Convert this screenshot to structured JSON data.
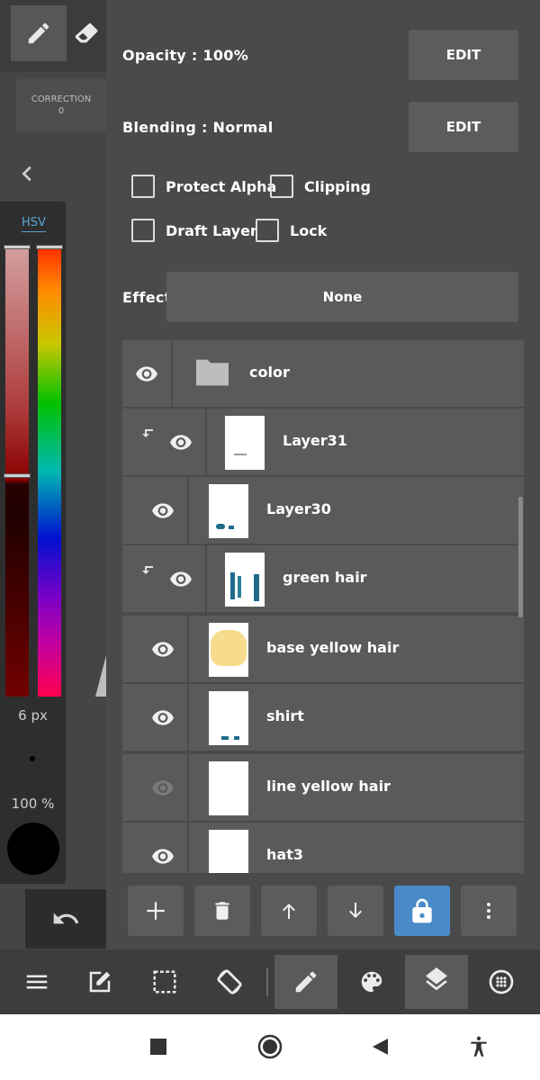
{
  "tools": {
    "correction_label": "CORRECTION",
    "correction_value": "0"
  },
  "color_panel": {
    "tab_label": "HSV",
    "brush_size": "6 px",
    "opacity": "100 %"
  },
  "layer_props": {
    "opacity_label": "Opacity : 100%",
    "blending_label": "Blending : Normal",
    "edit_label": "EDIT",
    "effect_label": "Effect",
    "effect_value": "None",
    "checkboxes": [
      {
        "label": "Protect Alpha",
        "checked": false
      },
      {
        "label": "Clipping",
        "checked": false
      },
      {
        "label": "Draft Layer",
        "checked": false
      },
      {
        "label": "Lock",
        "checked": false
      }
    ]
  },
  "layers": [
    {
      "name": "color",
      "type": "folder",
      "visible": true,
      "clipped": false
    },
    {
      "name": "Layer31",
      "type": "layer",
      "visible": true,
      "clipped": true
    },
    {
      "name": "Layer30",
      "type": "layer",
      "visible": true,
      "clipped": false
    },
    {
      "name": "green hair",
      "type": "layer",
      "visible": true,
      "clipped": true
    },
    {
      "name": "base yellow hair",
      "type": "layer",
      "visible": true,
      "clipped": false
    },
    {
      "name": "shirt",
      "type": "layer",
      "visible": true,
      "clipped": false
    },
    {
      "name": "line yellow hair",
      "type": "layer",
      "visible": false,
      "clipped": false
    },
    {
      "name": "hat3",
      "type": "layer",
      "visible": true,
      "clipped": false
    }
  ],
  "colors": {
    "accent": "#4a8ac8",
    "hsv_tab": "#5aa7d8",
    "panel_bg": "#4a4a4a",
    "row_bg": "#5a5a5a"
  },
  "icons": {
    "layer_actions": [
      "plus-icon",
      "trash-icon",
      "arrow-up-icon",
      "arrow-down-icon",
      "lock-icon",
      "more-vertical-icon"
    ],
    "bottom_bar": [
      "menu-icon",
      "edit-canvas-icon",
      "selection-icon",
      "rotate-icon",
      "pen-icon",
      "palette-icon",
      "layers-icon",
      "material-icon"
    ],
    "nav": [
      "square-icon",
      "home-circle-icon",
      "back-triangle-icon",
      "accessibility-icon"
    ]
  }
}
